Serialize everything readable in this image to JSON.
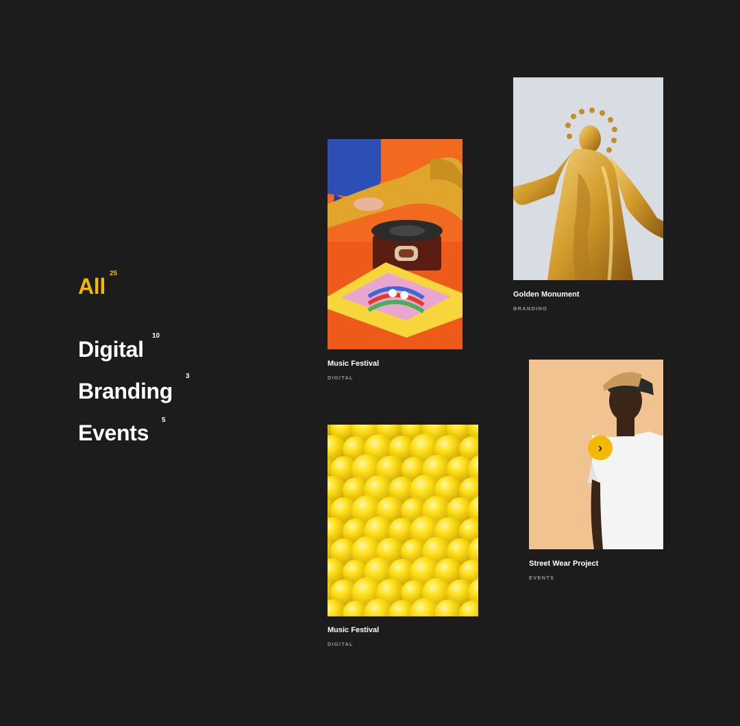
{
  "filters": [
    {
      "label": "All",
      "count": "25",
      "active": true
    },
    {
      "label": "Digital",
      "count": "10"
    },
    {
      "label": "Branding",
      "count": "3"
    },
    {
      "label": "Events",
      "count": "5"
    }
  ],
  "projects": [
    {
      "title": "Music Festival",
      "category": "DIGITAL",
      "image": "record-player-photo"
    },
    {
      "title": "Golden Monument",
      "category": "BRANDING",
      "image": "golden-statue-photo"
    },
    {
      "title": "Music Festival",
      "category": "DIGITAL",
      "image": "yellow-balls-photo"
    },
    {
      "title": "Street Wear Project",
      "category": "EVENTS",
      "image": "man-in-cap-photo"
    }
  ],
  "next_button": {
    "icon": "chevron-right-icon",
    "glyph": "›"
  },
  "colors": {
    "background": "#1c1c1c",
    "accent": "#f5b800",
    "text": "#ffffff",
    "muted": "#9a9a9a"
  }
}
